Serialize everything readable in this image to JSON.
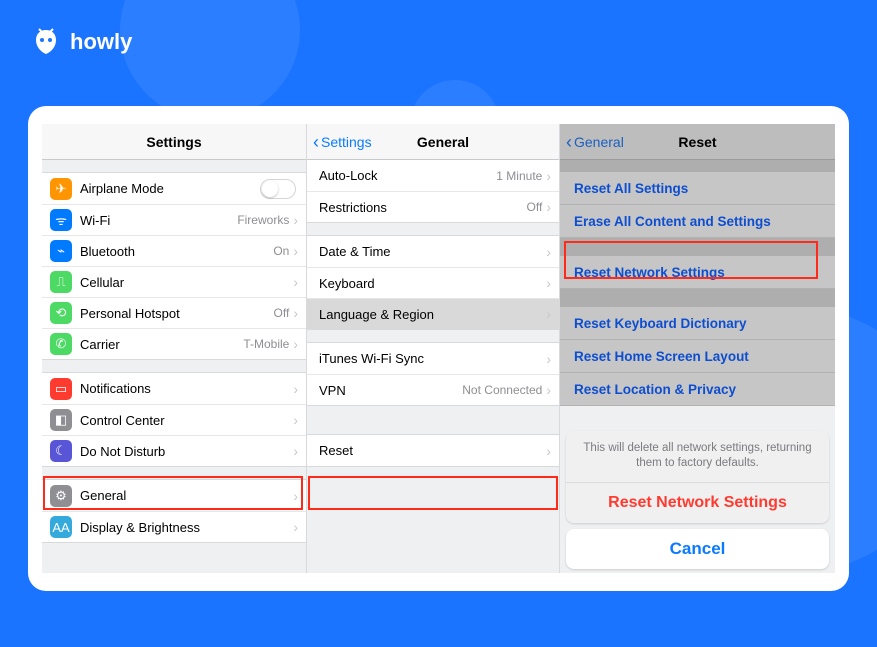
{
  "brand": {
    "name": "howly"
  },
  "settings": {
    "title": "Settings",
    "groups": [
      {
        "rows": [
          {
            "icon": "airplane-icon",
            "color": "ic-orange",
            "glyph": "✈",
            "label": "Airplane Mode",
            "toggle": true
          },
          {
            "icon": "wifi-icon",
            "color": "ic-blue",
            "glyph": "ᯤ",
            "label": "Wi-Fi",
            "detail": "Fireworks",
            "disclosure": true
          },
          {
            "icon": "bluetooth-icon",
            "color": "ic-blue",
            "glyph": "⌁",
            "label": "Bluetooth",
            "detail": "On",
            "disclosure": true
          },
          {
            "icon": "cellular-icon",
            "color": "ic-green",
            "glyph": "⎍",
            "label": "Cellular",
            "disclosure": true
          },
          {
            "icon": "hotspot-icon",
            "color": "ic-green",
            "glyph": "⟲",
            "label": "Personal Hotspot",
            "detail": "Off",
            "disclosure": true
          },
          {
            "icon": "carrier-icon",
            "color": "ic-green",
            "glyph": "✆",
            "label": "Carrier",
            "detail": "T-Mobile",
            "disclosure": true
          }
        ]
      },
      {
        "rows": [
          {
            "icon": "notifications-icon",
            "color": "ic-red",
            "glyph": "▭",
            "label": "Notifications",
            "disclosure": true
          },
          {
            "icon": "controlcenter-icon",
            "color": "ic-grey",
            "glyph": "◧",
            "label": "Control Center",
            "disclosure": true
          },
          {
            "icon": "dnd-icon",
            "color": "ic-purple",
            "glyph": "☾",
            "label": "Do Not Disturb",
            "disclosure": true
          }
        ]
      },
      {
        "rows": [
          {
            "icon": "general-icon",
            "color": "ic-grey",
            "glyph": "⚙",
            "label": "General",
            "disclosure": true
          },
          {
            "icon": "display-icon",
            "color": "ic-ltblue",
            "glyph": "AA",
            "label": "Display & Brightness",
            "disclosure": true
          }
        ]
      }
    ]
  },
  "general": {
    "back": "Settings",
    "title": "General",
    "groups": [
      {
        "rows": [
          {
            "label": "Auto-Lock",
            "detail": "1 Minute",
            "disclosure": true
          },
          {
            "label": "Restrictions",
            "detail": "Off",
            "disclosure": true
          }
        ]
      },
      {
        "rows": [
          {
            "label": "Date & Time",
            "disclosure": true
          },
          {
            "label": "Keyboard",
            "disclosure": true
          },
          {
            "label": "Language & Region",
            "disclosure": true,
            "selected": true
          }
        ]
      },
      {
        "rows": [
          {
            "label": "iTunes Wi-Fi Sync",
            "disclosure": true
          },
          {
            "label": "VPN",
            "detail": "Not Connected",
            "disclosure": true
          }
        ]
      },
      {
        "rows": [
          {
            "label": "Reset",
            "disclosure": true
          }
        ]
      }
    ]
  },
  "reset": {
    "back": "General",
    "title": "Reset",
    "rows": [
      {
        "label": "Reset All Settings"
      },
      {
        "label": "Erase All Content and Settings"
      },
      {
        "gap": true
      },
      {
        "label": "Reset Network Settings",
        "highlight": true
      },
      {
        "gap": true
      },
      {
        "label": "Reset Keyboard Dictionary"
      },
      {
        "label": "Reset Home Screen Layout"
      },
      {
        "label": "Reset Location & Privacy"
      }
    ],
    "sheet": {
      "message": "This will delete all network settings, returning them to factory defaults.",
      "destructive": "Reset Network Settings",
      "cancel": "Cancel"
    }
  }
}
